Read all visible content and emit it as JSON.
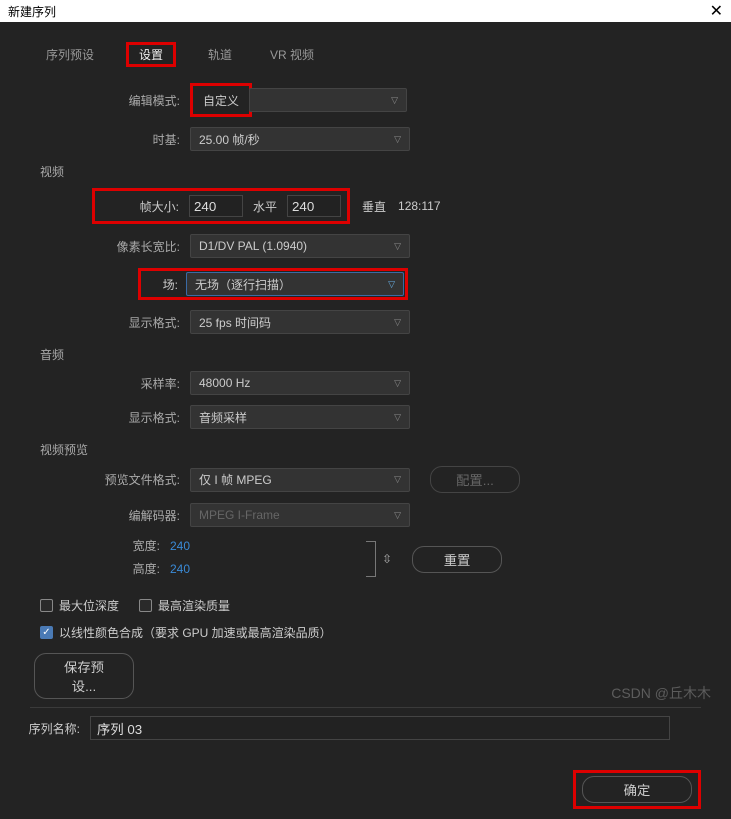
{
  "window": {
    "title": "新建序列",
    "close": "✕"
  },
  "tabs": [
    "序列预设",
    "设置",
    "轨道",
    "VR 视频"
  ],
  "activeTab": "设置",
  "fields": {
    "editMode": {
      "label": "编辑模式:",
      "value": "自定义"
    },
    "timebase": {
      "label": "时基:",
      "value": "25.00 帧/秒"
    },
    "video": {
      "title": "视频",
      "frameSize": {
        "label": "帧大小:",
        "w": "240",
        "hLabel": "水平",
        "h": "240",
        "vLabel": "垂直",
        "ratio": "128:117"
      },
      "pixelAspect": {
        "label": "像素长宽比:",
        "value": "D1/DV PAL (1.0940)"
      },
      "fields": {
        "label": "场:",
        "value": "无场（逐行扫描）"
      },
      "displayFormat": {
        "label": "显示格式:",
        "value": "25 fps 时间码"
      }
    },
    "audio": {
      "title": "音频",
      "sampleRate": {
        "label": "采样率:",
        "value": "48000 Hz"
      },
      "displayFormat": {
        "label": "显示格式:",
        "value": "音频采样"
      }
    },
    "preview": {
      "title": "视频预览",
      "fileFormat": {
        "label": "预览文件格式:",
        "value": "仅 I 帧 MPEG"
      },
      "codec": {
        "label": "编解码器:",
        "value": "MPEG I-Frame"
      },
      "width": {
        "label": "宽度:",
        "value": "240"
      },
      "height": {
        "label": "高度:",
        "value": "240"
      },
      "linkIcon": "⇳",
      "configBtn": "配置...",
      "resetBtn": "重置"
    },
    "checks": {
      "maxBitDepth": "最大位深度",
      "maxRenderQuality": "最高渲染质量",
      "linearColor": "以线性颜色合成（要求 GPU 加速或最高渲染品质）"
    },
    "savePreset": "保存预设...",
    "seqName": {
      "label": "序列名称:",
      "value": "序列 03"
    },
    "okBtn": "确定"
  },
  "watermark": "CSDN @丘木木"
}
